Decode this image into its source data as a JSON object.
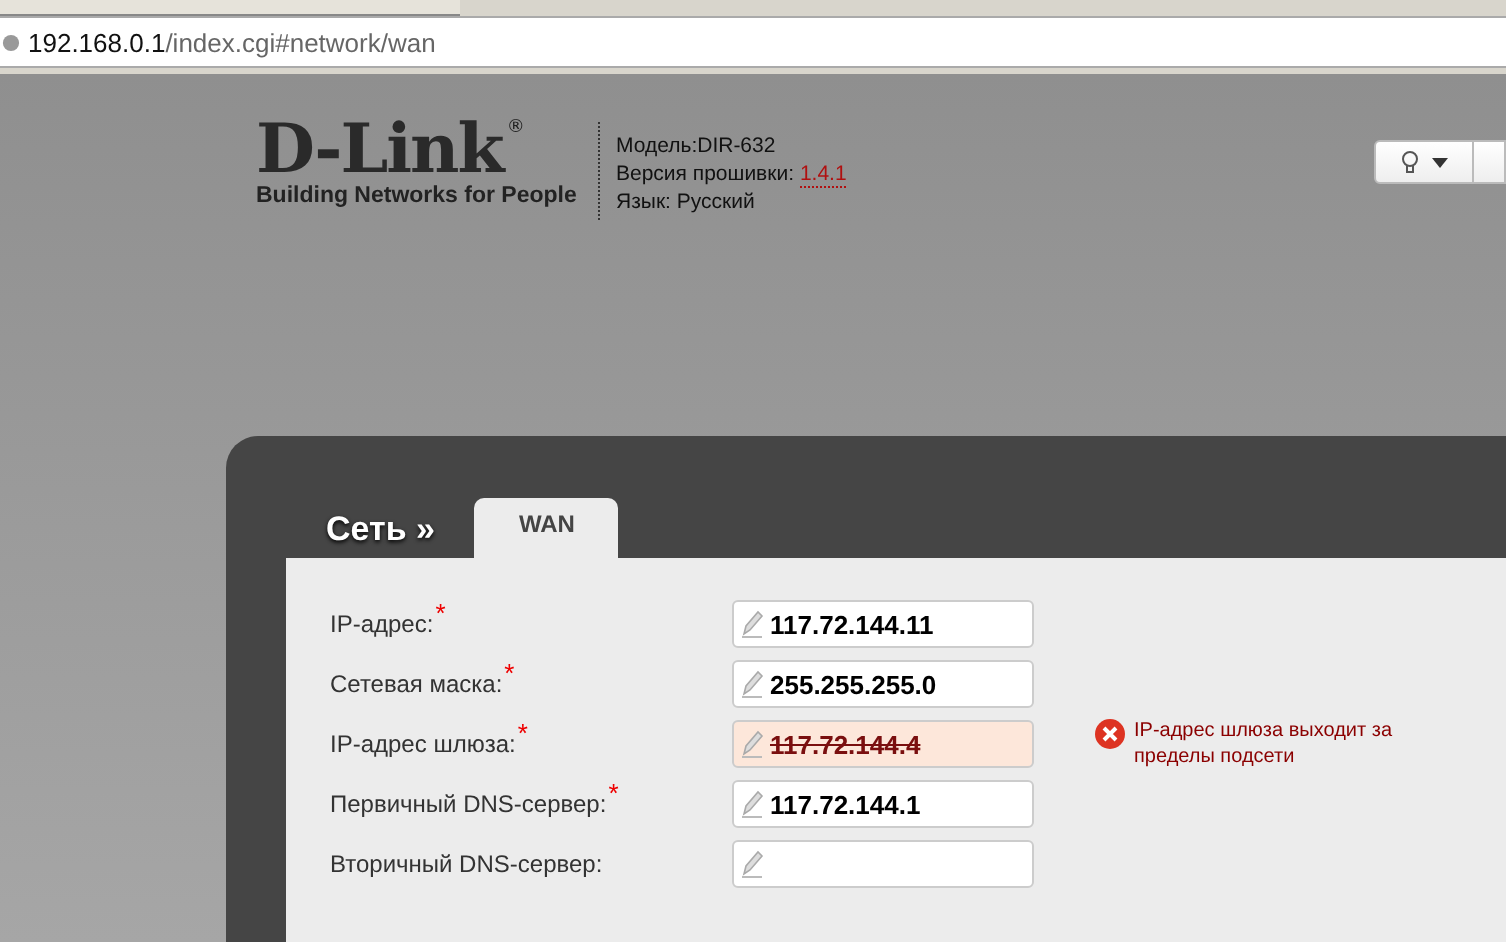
{
  "browser": {
    "url_host": "192.168.0.1",
    "url_path": "/index.cgi#network/wan"
  },
  "header": {
    "logo_text": "D-Link",
    "logo_mark": "®",
    "tagline": "Building Networks for People",
    "model": "Модель:DIR-632",
    "firmware_label": "Версия прошивки:",
    "firmware_version": "1.4.1",
    "language": "Язык: Русский"
  },
  "breadcrumb": "Сеть »",
  "tabs": [
    {
      "label": "WAN",
      "selected": true
    }
  ],
  "fields": [
    {
      "label": "IP-адрес:",
      "required": true,
      "value": "117.72.144.11",
      "error": false
    },
    {
      "label": "Сетевая маска:",
      "required": true,
      "value": "255.255.255.0",
      "error": false
    },
    {
      "label": "IP-адрес шлюза:",
      "required": true,
      "value": "117.72.144.4",
      "error": true,
      "error_message": "IP-адрес шлюза выходит за пределы подсети"
    },
    {
      "label": "Первичный DNS-сервер:",
      "required": true,
      "value": "117.72.144.1",
      "error": false
    },
    {
      "label": "Вторичный DNS-сервер:",
      "required": false,
      "error": false
    }
  ],
  "required_mark": "*"
}
